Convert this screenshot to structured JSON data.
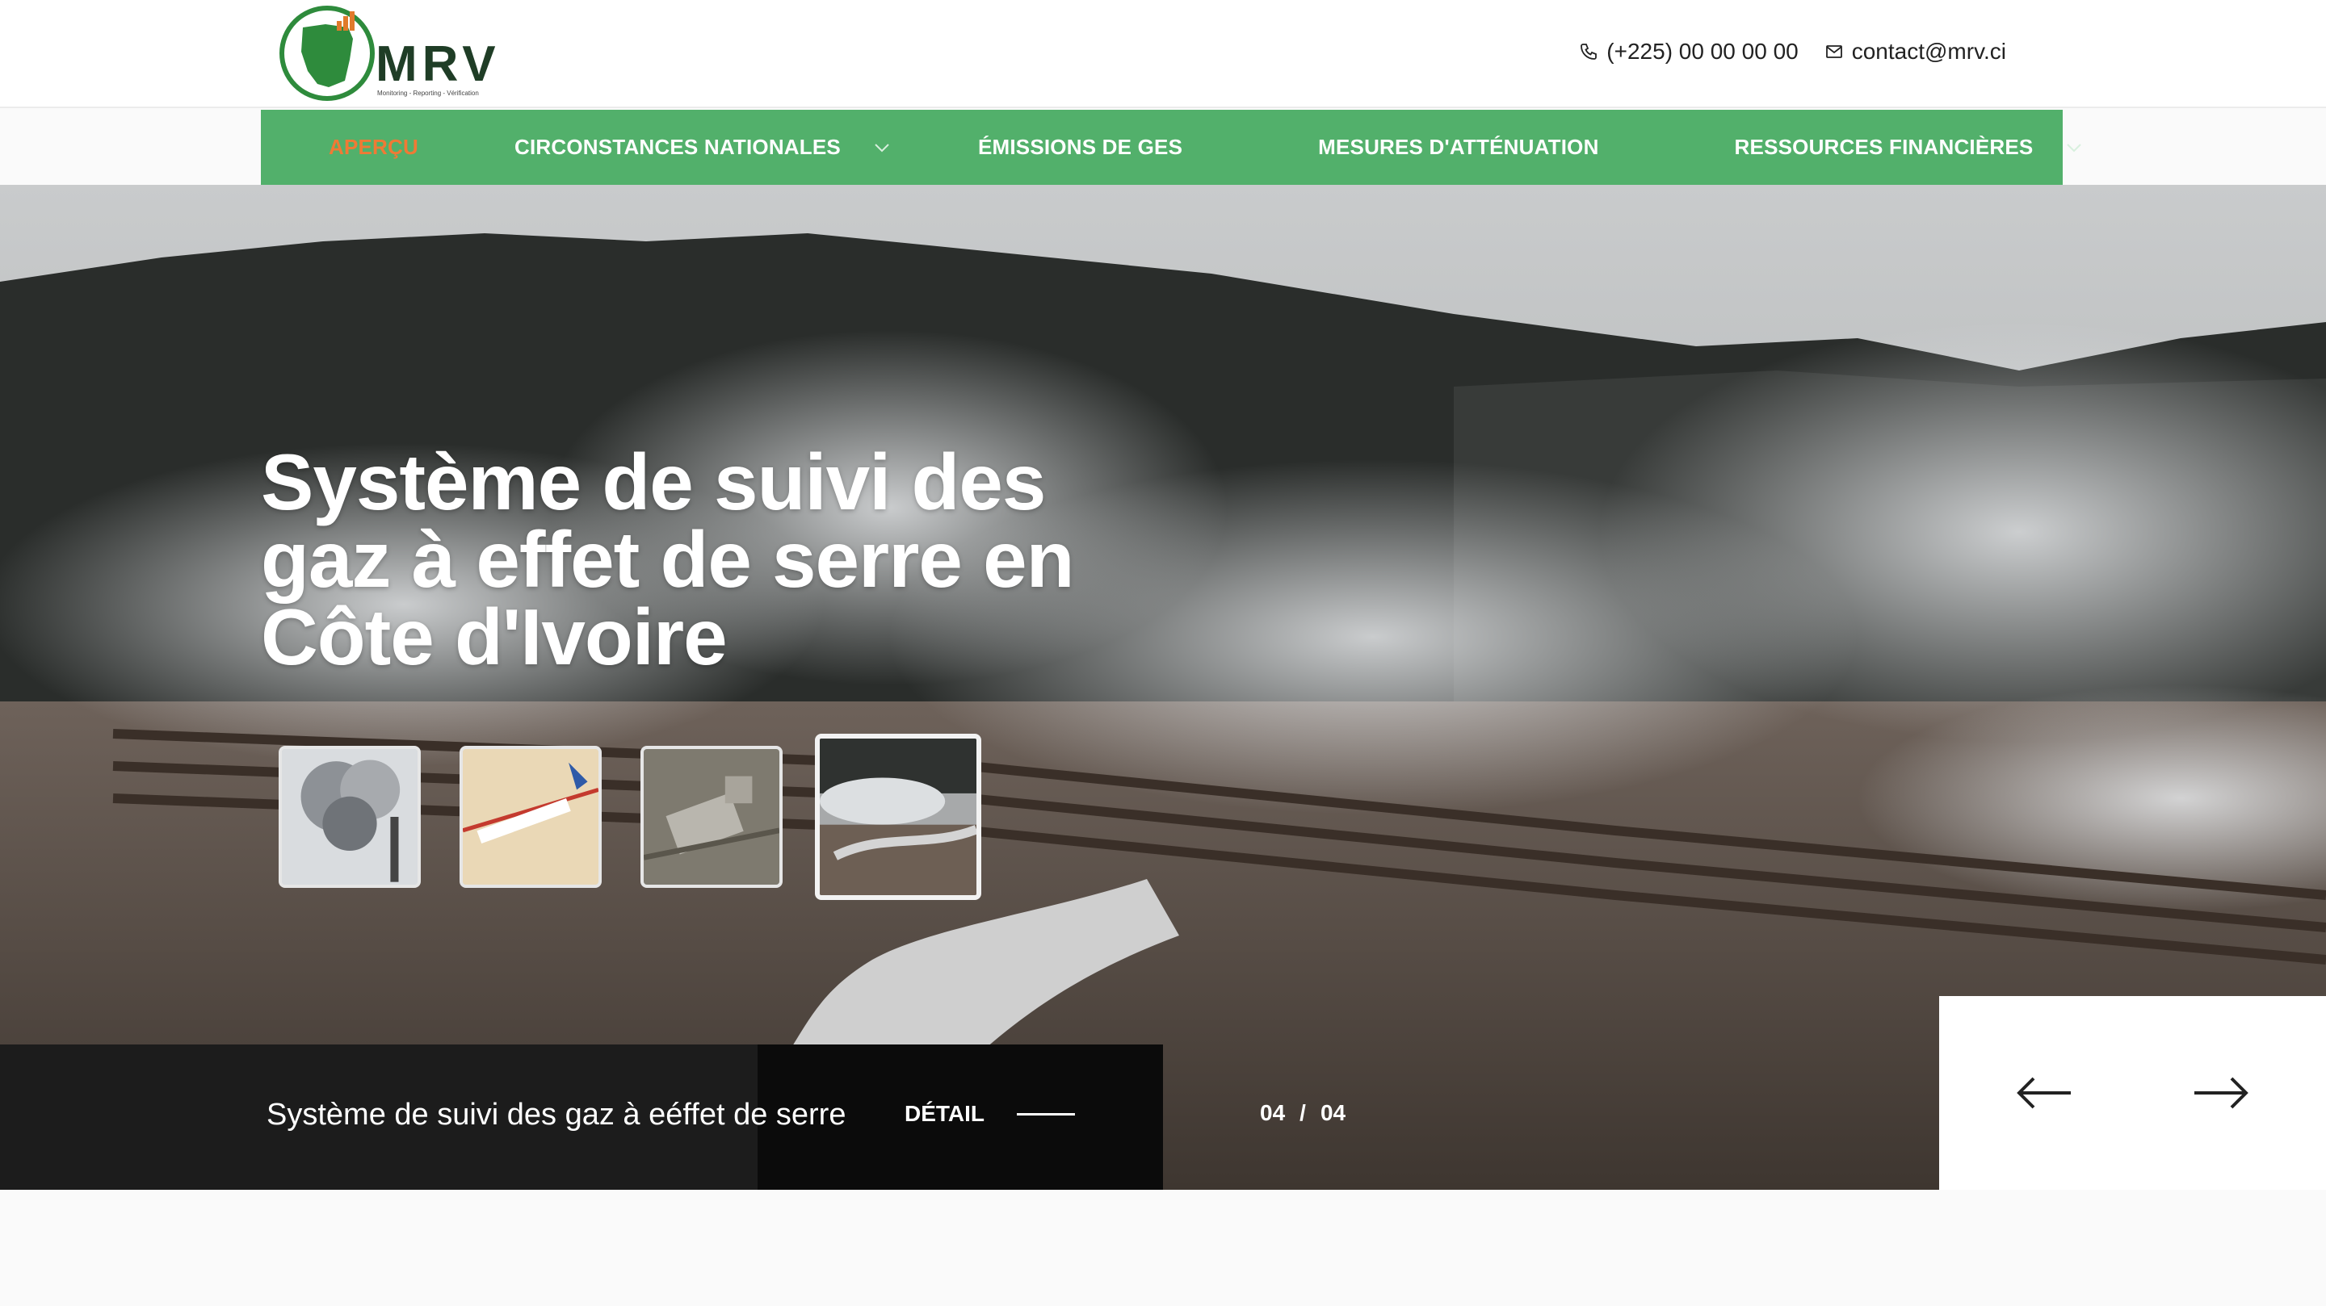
{
  "header": {
    "logo_text": "MRV",
    "logo_tagline": "Monitoring - Reporting - Vérification",
    "phone": "(+225) 00 00 00 00",
    "email": "contact@mrv.ci"
  },
  "nav": {
    "items": [
      {
        "label": "APERÇU",
        "active": true
      },
      {
        "label": "CIRCONSTANCES NATIONALES",
        "dropdown": true
      },
      {
        "label": "ÉMISSIONS DE GES"
      },
      {
        "label": "MESURES D'ATTÉNUATION"
      },
      {
        "label": "RESSOURCES FINANCIÈRES",
        "dropdown": true
      }
    ]
  },
  "hero": {
    "title_line1": "Système de suivi des",
    "title_line2": "gaz à effet de serre en",
    "title_line3": "Côte d'Ivoire",
    "thumbnails": [
      {
        "subject": "industrial smoke"
      },
      {
        "subject": "map of Ivory Coast"
      },
      {
        "subject": "aerial industrial plant"
      },
      {
        "subject": "geothermal boardwalk",
        "active": true
      }
    ]
  },
  "caption": {
    "text": "Système de suivi des gaz à eéffet de serre",
    "detail_label": "DÉTAIL",
    "current": "04",
    "separator": "/",
    "total": "04"
  },
  "colors": {
    "nav_green": "#52b06b",
    "active_orange": "#f07a35",
    "logo_green": "#2e8b3c",
    "logo_text": "#1f3d26"
  },
  "icons": [
    "phone-icon",
    "mail-icon",
    "chevron-down-icon",
    "arrow-left-icon",
    "arrow-right-icon"
  ]
}
